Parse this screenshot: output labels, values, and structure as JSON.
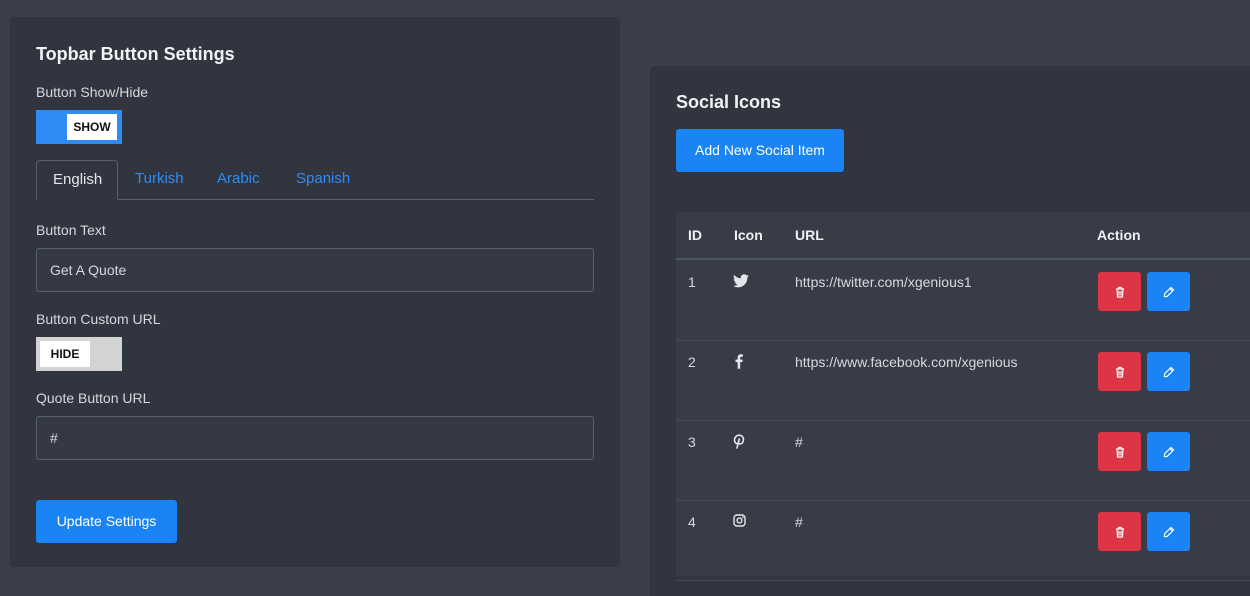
{
  "topbar": {
    "title": "Topbar Button Settings",
    "show_hide_label": "Button Show/Hide",
    "show_hide_toggle": "SHOW",
    "tabs": [
      {
        "label": "English"
      },
      {
        "label": "Turkish"
      },
      {
        "label": "Arabic"
      },
      {
        "label": "Spanish"
      }
    ],
    "button_text_label": "Button Text",
    "button_text_value": "Get A Quote",
    "custom_url_label": "Button Custom URL",
    "custom_url_toggle": "HIDE",
    "quote_url_label": "Quote Button URL",
    "quote_url_value": "#",
    "update_button": "Update Settings"
  },
  "social": {
    "title": "Social Icons",
    "add_button": "Add New Social Item",
    "columns": [
      "ID",
      "Icon",
      "URL",
      "Action"
    ],
    "rows": [
      {
        "id": "1",
        "icon": "twitter-icon",
        "url": "https://twitter.com/xgenious1"
      },
      {
        "id": "2",
        "icon": "facebook-icon",
        "url": "https://www.facebook.com/xgenious"
      },
      {
        "id": "3",
        "icon": "pinterest-icon",
        "url": "#"
      },
      {
        "id": "4",
        "icon": "instagram-icon",
        "url": "#"
      }
    ]
  },
  "colors": {
    "background": "#393e4a",
    "card": "#31353f",
    "primary": "#1a84f5",
    "danger": "#dc3545"
  }
}
